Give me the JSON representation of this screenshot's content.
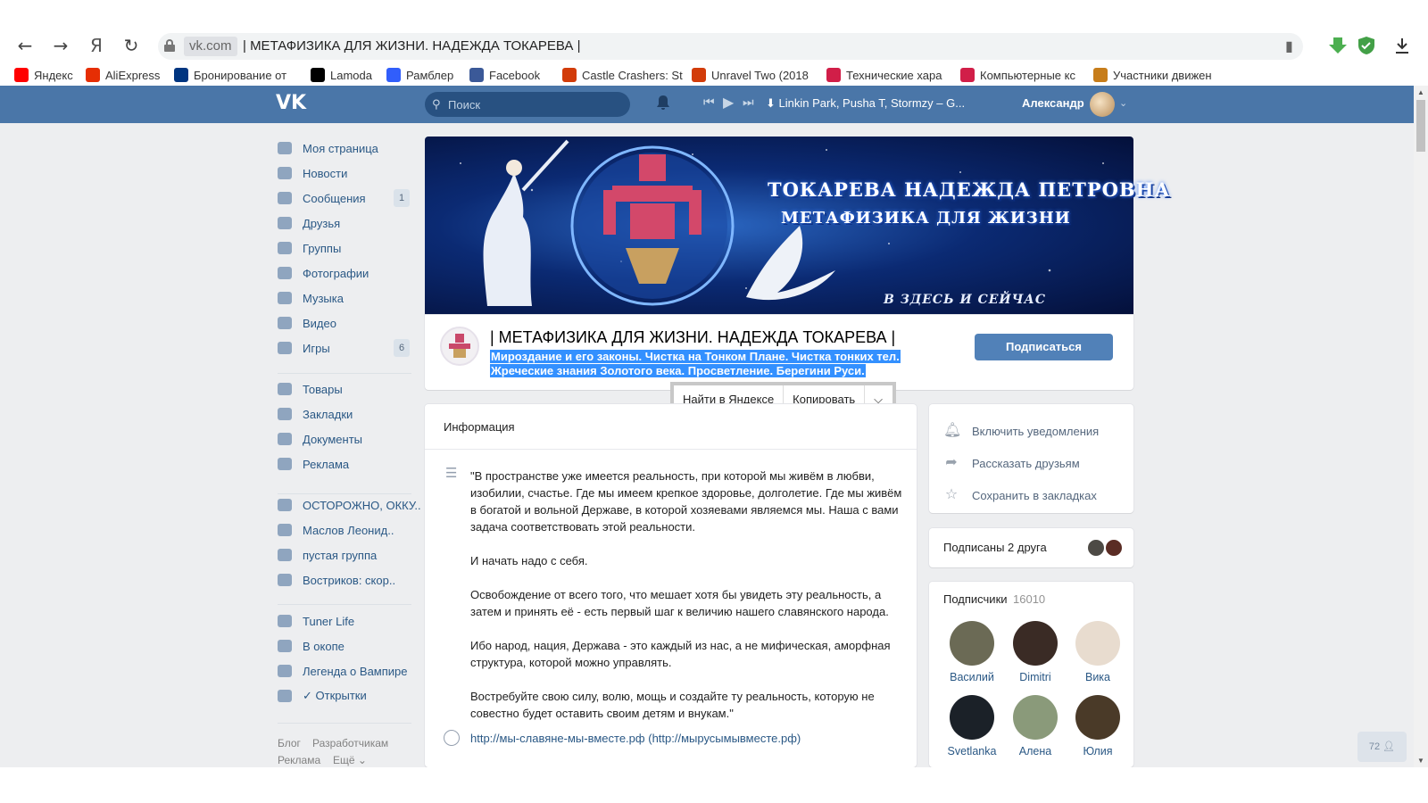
{
  "browser": {
    "domain": "vk.com",
    "tab_title": "| МЕТАФИЗИКА ДЛЯ ЖИЗНИ. НАДЕЖДА ТОКАРЕВА |",
    "bookmarks": [
      {
        "label": "Яндекс",
        "icon": "yandex-icon",
        "color": "#ff0000"
      },
      {
        "label": "AliExpress",
        "icon": "aliexpress-icon",
        "color": "#e62e04"
      },
      {
        "label": "Бронирование от",
        "icon": "booking-icon",
        "color": "#003580"
      },
      {
        "label": "Lamoda",
        "icon": "lamoda-icon",
        "color": "#000000"
      },
      {
        "label": "Рамблер",
        "icon": "rambler-icon",
        "color": "#315efb"
      },
      {
        "label": "Facebook",
        "icon": "facebook-icon",
        "color": "#3b5998"
      },
      {
        "label": "Castle Crashers: St",
        "icon": "castle-crashers-icon",
        "color": "#d23c0a"
      },
      {
        "label": "Unravel Two (2018",
        "icon": "unravel-icon",
        "color": "#d23c0a"
      },
      {
        "label": "Технические хара",
        "icon": "tech-specs-icon",
        "color": "#d11e48"
      },
      {
        "label": "Компьютерные кс",
        "icon": "computer-icon",
        "color": "#d11e48"
      },
      {
        "label": "Участники движен",
        "icon": "participants-icon",
        "color": "#c77d1a"
      }
    ]
  },
  "header": {
    "search_placeholder": "Поиск",
    "track": "Linkin Park, Pusha T, Stormzy – G...",
    "username": "Александр"
  },
  "sidebar": {
    "items": [
      {
        "label": "Моя страница",
        "icon": "home-icon"
      },
      {
        "label": "Новости",
        "icon": "news-icon"
      },
      {
        "label": "Сообщения",
        "icon": "messages-icon",
        "badge": "1"
      },
      {
        "label": "Друзья",
        "icon": "friends-icon"
      },
      {
        "label": "Группы",
        "icon": "groups-icon"
      },
      {
        "label": "Фотографии",
        "icon": "camera-icon"
      },
      {
        "label": "Музыка",
        "icon": "music-icon"
      },
      {
        "label": "Видео",
        "icon": "video-icon"
      },
      {
        "label": "Игры",
        "icon": "games-icon",
        "badge": "6"
      },
      {
        "label": "Товары",
        "icon": "shop-icon"
      },
      {
        "label": "Закладки",
        "icon": "star-icon"
      },
      {
        "label": "Документы",
        "icon": "documents-icon"
      },
      {
        "label": "Реклама",
        "icon": "ads-icon"
      },
      {
        "label": "ОСТОРОЖНО, ОККУ..",
        "icon": "group-icon"
      },
      {
        "label": "Маслов Леонид..",
        "icon": "group-icon"
      },
      {
        "label": "пустая группа",
        "icon": "group-icon"
      },
      {
        "label": "Востриков: скор..",
        "icon": "group-icon"
      },
      {
        "label": "Tuner Life",
        "icon": "car-icon"
      },
      {
        "label": "В окопе",
        "icon": "anchor-icon"
      },
      {
        "label": "Легенда о Вампире",
        "icon": "crown-icon"
      },
      {
        "label": "✓ Открытки",
        "icon": "apps-icon"
      }
    ],
    "footer": [
      "Блог",
      "Разработчикам",
      "Реклама",
      "Ещё ⌄"
    ]
  },
  "cover": {
    "title1": "ТОКАРЕВА НАДЕЖДА ПЕТРОВНА",
    "title2": "МЕТАФИЗИКА ДЛЯ ЖИЗНИ",
    "subtitle": "В ЗДЕСЬ И СЕЙЧАС"
  },
  "group": {
    "name": "| МЕТАФИЗИКА ДЛЯ ЖИЗНИ. НАДЕЖДА ТОКАРЕВА |",
    "status": "Мироздание и его законы. Чистка на Тонком Плане. Чистка тонких тел. Жреческие знания Золотого века. Просветление. Берегини Руси.",
    "subscribe_label": "Подписаться"
  },
  "selection_popup": {
    "find": "Найти в Яндексе",
    "copy": "Копировать",
    "more": "⌵"
  },
  "info": {
    "title": "Информация",
    "paragraphs": [
      "\"В пространстве уже имеется реальность, при которой мы живём в любви, изобилии, счастье. Где мы имеем крепкое здоровье, долголетие. Где мы живём в богатой и вольной Державе, в которой хозяевами являемся мы. Наша с вами задача соответствовать этой реальности.",
      "И начать надо с себя.",
      "Освобождение от всего того, что мешает хотя бы увидеть эту реальность, а затем и принять её - есть первый шаг к величию нашего славянского народа.",
      "Ибо народ, нация, Держава - это каждый из нас, а не мифическая, аморфная структура, которой можно управлять.",
      "Востребуйте свою силу, волю, мощь и создайте ту реальность, которую не совестно будет оставить своим детям и внукам.\""
    ],
    "site_link": "http://мы-славяне-мы-вместе.рф",
    "site_link_alt": "(http://мырусымывместе.рф)"
  },
  "actions": [
    {
      "label": "Включить уведомления",
      "icon": "bell-icon"
    },
    {
      "label": "Рассказать друзьям",
      "icon": "share-icon"
    },
    {
      "label": "Сохранить в закладках",
      "icon": "star-icon"
    }
  ],
  "friends_subscribed": "Подписаны 2 друга",
  "subscribers": {
    "title": "Подписчики",
    "count": "16010",
    "people": [
      {
        "name": "Василий",
        "color": "#6b6a55"
      },
      {
        "name": "Dimitri",
        "color": "#3a2b25"
      },
      {
        "name": "Вика",
        "color": "#e8dccf"
      },
      {
        "name": "Svetlanka",
        "color": "#1b2128"
      },
      {
        "name": "Алена",
        "color": "#8a9a7a"
      },
      {
        "name": "Юлия",
        "color": "#4a3a28"
      }
    ]
  },
  "online_count": "72"
}
